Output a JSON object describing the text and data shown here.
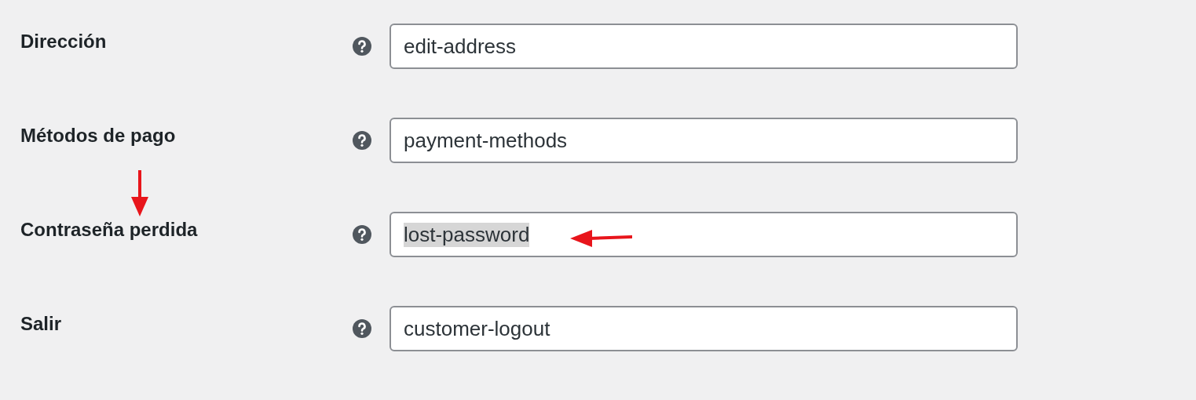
{
  "settings": [
    {
      "label": "Dirección",
      "value": "edit-address",
      "highlighted": false,
      "label_arrow": false,
      "field_arrow": false
    },
    {
      "label": "Métodos de pago",
      "value": "payment-methods",
      "highlighted": false,
      "label_arrow": false,
      "field_arrow": false
    },
    {
      "label": "Contraseña perdida",
      "value": "lost-password",
      "highlighted": true,
      "label_arrow": true,
      "field_arrow": true
    },
    {
      "label": "Salir",
      "value": "customer-logout",
      "highlighted": false,
      "label_arrow": false,
      "field_arrow": false
    }
  ]
}
